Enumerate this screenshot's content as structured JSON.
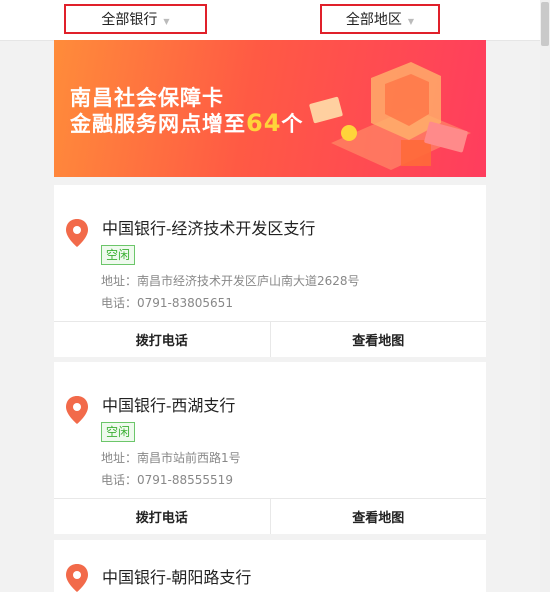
{
  "filters": {
    "bank_label": "全部银行",
    "region_label": "全部地区"
  },
  "banner": {
    "line1": "南昌社会保障卡",
    "line2_prefix": "金融服务网点增至",
    "line2_number": "64",
    "line2_suffix": "个"
  },
  "branches": [
    {
      "name": "中国银行-经济技术开发区支行",
      "status": "空闲",
      "address": "地址：南昌市经济技术开发区庐山南大道2628号",
      "phone": "电话：0791-83805651",
      "call_label": "拨打电话",
      "map_label": "查看地图"
    },
    {
      "name": "中国银行-西湖支行",
      "status": "空闲",
      "address": "地址：南昌市站前西路1号",
      "phone": "电话：0791-88555519",
      "call_label": "拨打电话",
      "map_label": "查看地图"
    },
    {
      "name": "中国银行-朝阳路支行"
    }
  ],
  "colors": {
    "pin": "#f26a4a",
    "status_green": "#3cb034",
    "highlight_border": "#e0202a"
  }
}
